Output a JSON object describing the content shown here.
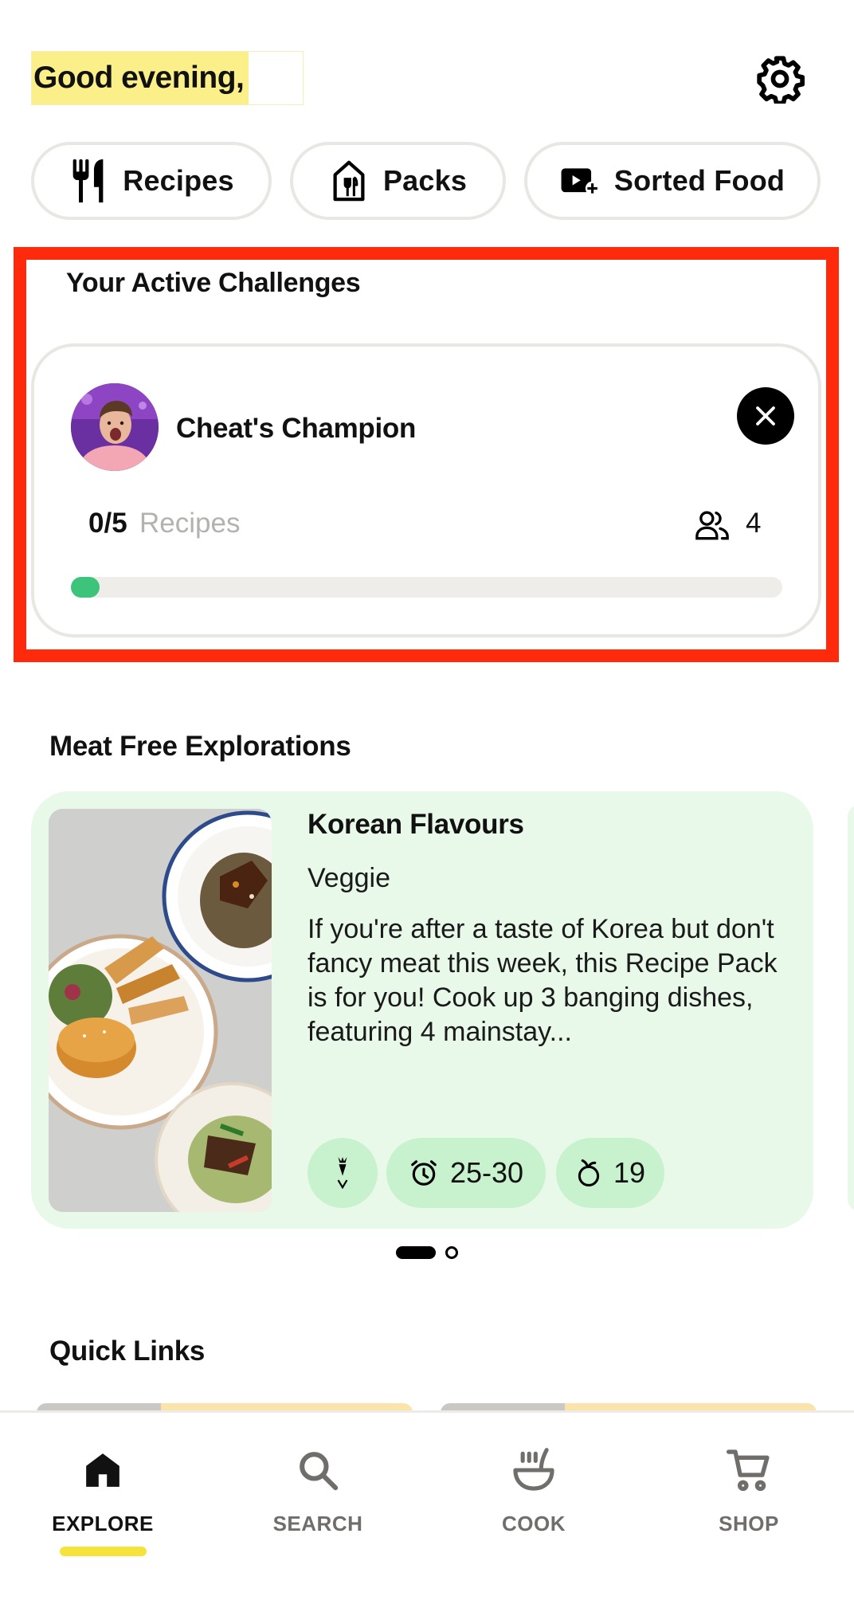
{
  "header": {
    "greeting": "Good evening,"
  },
  "pills": [
    {
      "label": "Recipes",
      "icon": "fork-knife-icon"
    },
    {
      "label": "Packs",
      "icon": "pack-house-icon"
    },
    {
      "label": "Sorted Food",
      "icon": "video-add-icon"
    }
  ],
  "challenges": {
    "title": "Your Active Challenges",
    "items": [
      {
        "name": "Cheat's Champion",
        "progress_text": "0/5",
        "progress_unit": "Recipes",
        "members": "4",
        "progress_fraction": 0.04,
        "progress_color": "#3bc47a"
      }
    ]
  },
  "meat_free": {
    "title": "Meat Free Explorations",
    "cards": [
      {
        "title": "Korean Flavours",
        "tag": "Veggie",
        "description": "If you're after a taste of Korea but don't fancy meat this week, this Recipe Pack is for you! Cook up 3 banging dishes, featuring 4 mainstay...",
        "time": "25-30",
        "ingredients": "19",
        "background": "#e9f9e9"
      }
    ],
    "pager": {
      "count": 2,
      "active_index": 0
    }
  },
  "quick_links": {
    "title": "Quick Links"
  },
  "bottom_nav": [
    {
      "label": "EXPLORE",
      "icon": "home-icon",
      "active": true
    },
    {
      "label": "SEARCH",
      "icon": "search-icon",
      "active": false
    },
    {
      "label": "COOK",
      "icon": "cook-pot-icon",
      "active": false
    },
    {
      "label": "SHOP",
      "icon": "cart-icon",
      "active": false
    }
  ],
  "colors": {
    "accent_yellow": "#f7e23a",
    "highlight_red": "#ff2a0c",
    "card_green": "#e9f9e9",
    "chip_green": "#c7f2cd"
  }
}
